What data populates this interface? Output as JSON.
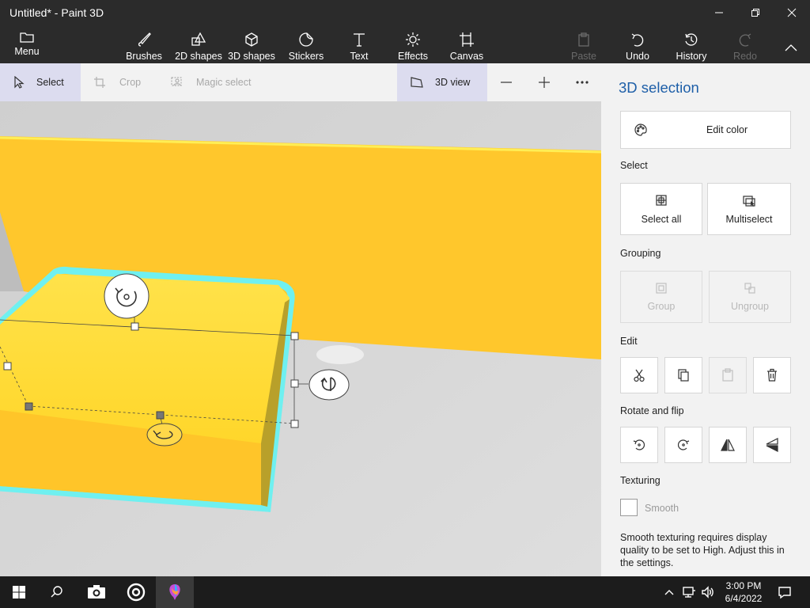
{
  "window": {
    "title": "Untitled* - Paint 3D"
  },
  "toolbar": {
    "menu": "Menu",
    "brushes": "Brushes",
    "shapes2d": "2D shapes",
    "shapes3d": "3D shapes",
    "stickers": "Stickers",
    "text": "Text",
    "effects": "Effects",
    "canvas": "Canvas",
    "paste": "Paste",
    "undo": "Undo",
    "history": "History",
    "redo": "Redo"
  },
  "subbar": {
    "select": "Select",
    "crop": "Crop",
    "magic_select": "Magic select",
    "view3d": "3D view"
  },
  "panel": {
    "title": "3D selection",
    "edit_color": "Edit color",
    "select_heading": "Select",
    "select_all": "Select all",
    "multiselect": "Multiselect",
    "grouping_heading": "Grouping",
    "group": "Group",
    "ungroup": "Ungroup",
    "edit_heading": "Edit",
    "rotate_heading": "Rotate and flip",
    "texturing_heading": "Texturing",
    "smooth": "Smooth",
    "smooth_note": "Smooth texturing requires display quality to be set to High. Adjust this in the settings."
  },
  "taskbar": {
    "time": "3:00 PM",
    "date": "6/4/2022"
  },
  "colors": {
    "accent": "#1e5fa8",
    "shape_yellow": "#ffd21f",
    "wall_yellow": "#ffc72c",
    "selection_cyan": "#6ff0f0"
  }
}
